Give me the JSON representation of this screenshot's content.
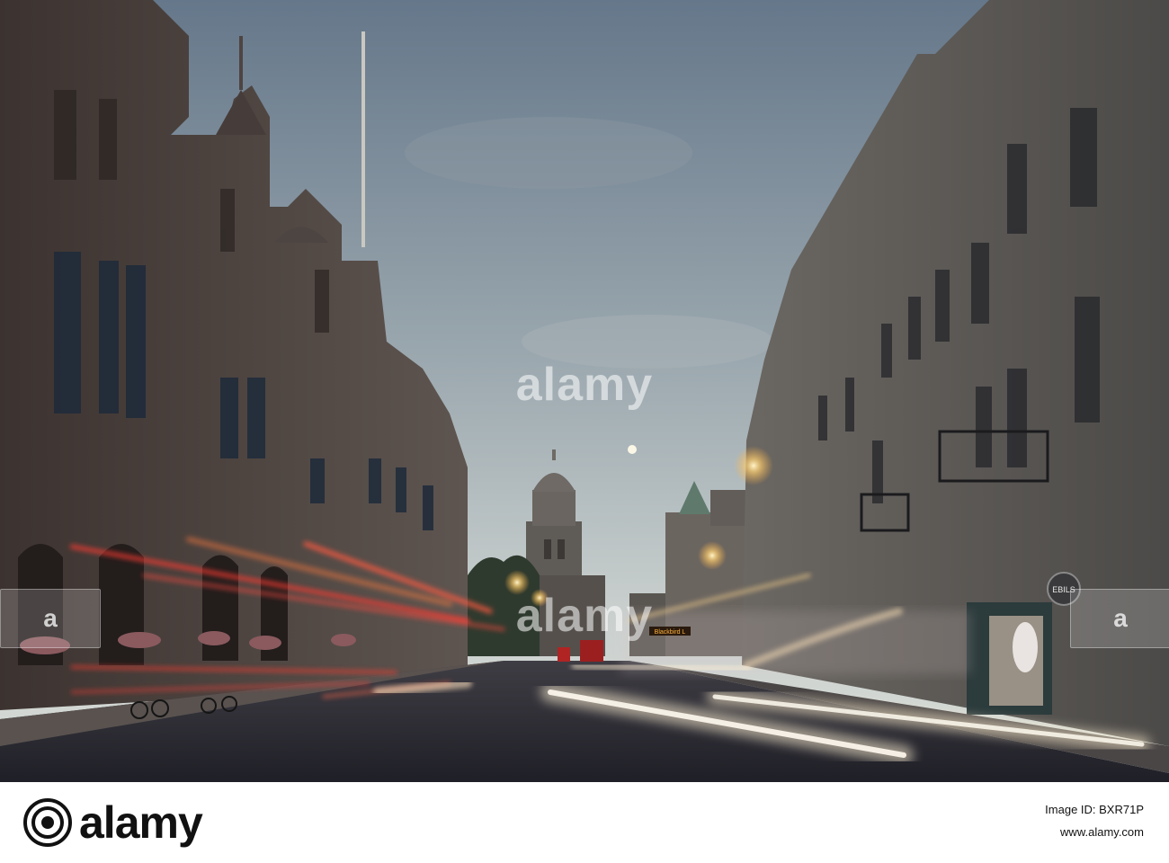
{
  "watermark": {
    "center_top": "alamy",
    "center_mid": "alamy",
    "left_side": "a",
    "right_side": "a"
  },
  "storefront": {
    "sign": "EBILS"
  },
  "bus": {
    "destination": "Blackbird L"
  },
  "footer": {
    "logo_text": "alamy",
    "image_id": "Image ID: BXR71P",
    "site": "www.alamy.com"
  },
  "colors": {
    "sky_top": "#6f8090",
    "sky_horizon": "#cfd4d1",
    "building_left": "#4a423f",
    "building_right": "#5d5a57",
    "road": "#2b2b33",
    "red_trail": "#ff3b30",
    "white_trail": "#fff3d6",
    "lamp": "#ffd27a",
    "footer_bg": "#ffffff"
  }
}
